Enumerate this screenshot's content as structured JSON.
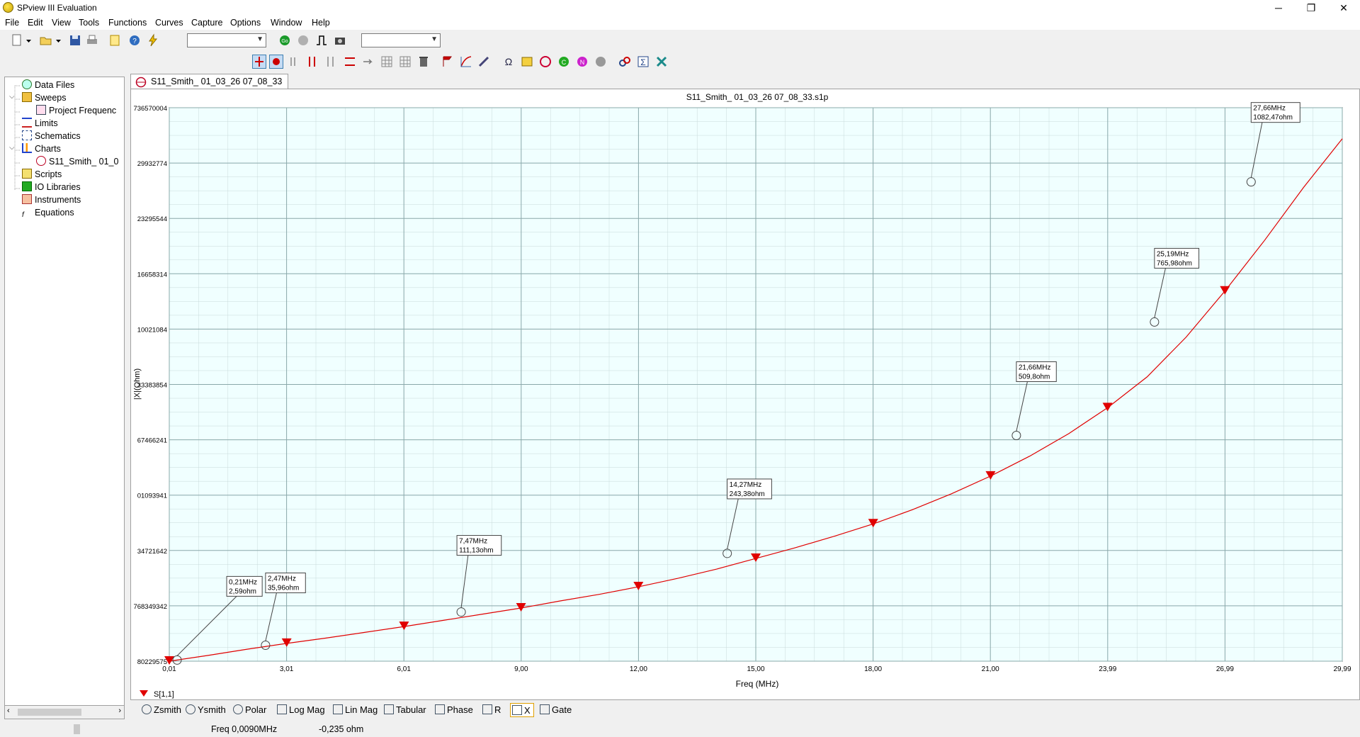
{
  "window": {
    "title": "SPview III Evaluation",
    "minimize": "─",
    "restore": "❐",
    "close": "✕"
  },
  "menu": [
    "File",
    "Edit",
    "View",
    "Tools",
    "Functions",
    "Curves",
    "Capture",
    "Options",
    "Window",
    "Help"
  ],
  "tree": {
    "items": [
      {
        "label": "Data Files",
        "icon": "data-files-icon"
      },
      {
        "label": "Sweeps",
        "icon": "sweeps-icon"
      },
      {
        "label": "Project Frequenc",
        "icon": "project-frequency-icon"
      },
      {
        "label": "Limits",
        "icon": "limits-icon"
      },
      {
        "label": "Schematics",
        "icon": "schematics-icon"
      },
      {
        "label": "Charts",
        "icon": "charts-icon"
      },
      {
        "label": "S11_Smith_ 01_0",
        "icon": "smith-chart-icon"
      },
      {
        "label": "Scripts",
        "icon": "scripts-icon"
      },
      {
        "label": "IO Libraries",
        "icon": "io-libraries-icon"
      },
      {
        "label": "Instruments",
        "icon": "instruments-icon"
      },
      {
        "label": "Equations",
        "icon": "equations-icon"
      }
    ]
  },
  "doc_tab": {
    "label": "S11_Smith_ 01_03_26 07_08_33"
  },
  "bottom_tabs": [
    "Zsmith",
    "Ysmith",
    "Polar",
    "Log Mag",
    "Lin Mag",
    "Tabular",
    "Phase",
    "R",
    "X",
    "Gate"
  ],
  "status": {
    "freq": "Freq  0,0090MHz",
    "value": "-0,235 ohm"
  },
  "chart_data": {
    "type": "line",
    "title": "S11_Smith_ 01_03_26 07_08_33.s1p",
    "xlabel": "Freq (MHz)",
    "ylabel": "|X|(Ohm)",
    "x_ticks": [
      "0,01",
      "3,01",
      "6,01",
      "9,00",
      "12,00",
      "15,00",
      "18,00",
      "21,00",
      "23,99",
      "26,99",
      "29,99"
    ],
    "y_ticks": [
      "80229575",
      "768349342",
      "34721642",
      "01093941",
      "67466241",
      "33383854",
      "10021084",
      "16658314",
      "23295544",
      "29932774",
      "736570004"
    ],
    "xlim": [
      0.01,
      29.99
    ],
    "ylim": [
      0,
      1250
    ],
    "grid": true,
    "legend": "bottom-left",
    "series": [
      {
        "name": "S[1,1]",
        "color": "#e00000",
        "x": [
          0.01,
          1,
          2,
          3,
          4,
          5,
          6,
          7,
          8,
          9,
          10,
          11,
          12,
          13,
          14,
          15,
          16,
          17,
          18,
          19,
          20,
          21,
          22,
          23,
          24,
          25,
          26,
          27,
          28,
          29,
          29.99
        ],
        "y": [
          0,
          13,
          27,
          40,
          52,
          65,
          78,
          92,
          106,
          120,
          136,
          151,
          168,
          187,
          208,
          232,
          256,
          282,
          310,
          342,
          378,
          418,
          463,
          514,
          573,
          642,
          732,
          837,
          950,
          1070,
          1180
        ]
      }
    ],
    "marker_freqs": [
      0.01,
      3.01,
      6.01,
      9.0,
      12.0,
      15.0,
      18.0,
      21.0,
      23.99,
      26.99
    ],
    "annotations": [
      {
        "freq": "0,21MHz",
        "value": "2,59ohm",
        "x": 0.21,
        "y": 2.59
      },
      {
        "freq": "2,47MHz",
        "value": "35,96ohm",
        "x": 2.47,
        "y": 35.96
      },
      {
        "freq": "7,47MHz",
        "value": "111,13ohm",
        "x": 7.47,
        "y": 111.13
      },
      {
        "freq": "14,27MHz",
        "value": "243,38ohm",
        "x": 14.27,
        "y": 243.38
      },
      {
        "freq": "21,66MHz",
        "value": "509,8ohm",
        "x": 21.66,
        "y": 509.8
      },
      {
        "freq": "25,19MHz",
        "value": "765,98ohm",
        "x": 25.19,
        "y": 765.98
      },
      {
        "freq": "27,66MHz",
        "value": "1082,47ohm",
        "x": 27.66,
        "y": 1082.47
      }
    ]
  }
}
